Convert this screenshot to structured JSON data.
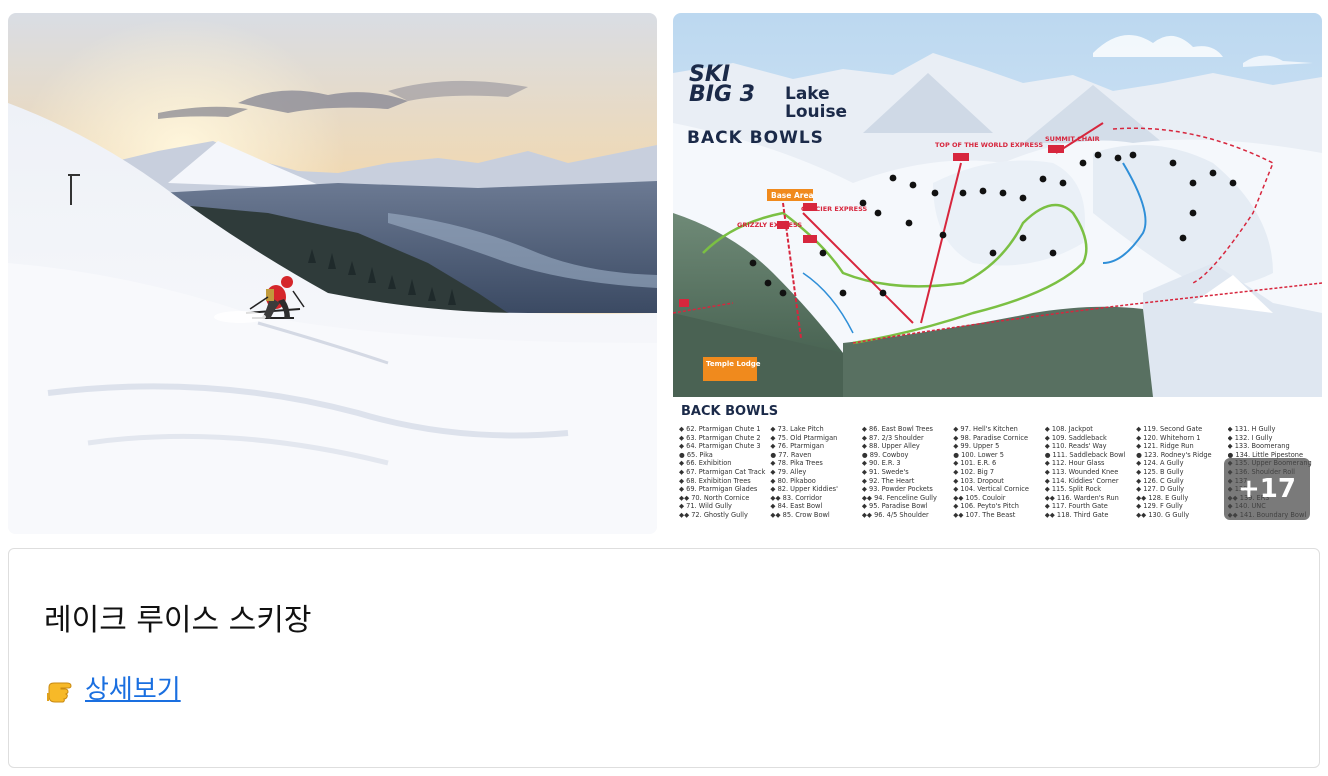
{
  "gallery": {
    "photos": [
      {
        "alt_icon": "skier-photo"
      },
      {
        "alt_icon": "trail-map"
      }
    ],
    "more_count_label": "+17"
  },
  "trail_map": {
    "logo_ski": "SKI BIG 3",
    "logo_resort": "Lake Louise",
    "area_title": "BACK BOWLS",
    "legend_heading": "BACK BOWLS",
    "base_area_label": "Base Area",
    "temple_lodge_label": "Temple Lodge",
    "lifts": [
      "SUMMIT CHAIR",
      "TOP OF THE WORLD EXPRESS",
      "GLACIER EXPRESS",
      "GRIZZLY EXPRESS"
    ],
    "legend_columns": [
      [
        "62. Ptarmigan Chute 1",
        "63. Ptarmigan Chute 2",
        "64. Ptarmigan Chute 3",
        "65. Pika",
        "66. Exhibition",
        "67. Ptarmigan Cat Track",
        "68. Exhibition Trees",
        "69. Ptarmigan Glades",
        "70. North Cornice",
        "71. Wild Gully",
        "72. Ghostly Gully"
      ],
      [
        "73. Lake Pitch",
        "75. Old Ptarmigan",
        "76. Ptarmigan",
        "77. Raven",
        "78. Pika Trees",
        "79. Alley",
        "80. Pikaboo",
        "82. Upper Kiddies'",
        "83. Corridor",
        "84. East Bowl",
        "85. Crow Bowl"
      ],
      [
        "86. East Bowl Trees",
        "87. 2/3 Shoulder",
        "88. Upper Alley",
        "89. Cowboy",
        "90. E.R. 3",
        "91. Swede's",
        "92. The Heart",
        "93. Powder Pockets",
        "94. Fenceline Gully",
        "95. Paradise Bowl",
        "96. 4/5 Shoulder"
      ],
      [
        "97. Hell's Kitchen",
        "98. Paradise Cornice",
        "99. Upper 5",
        "100. Lower 5",
        "101. E.R. 6",
        "102. Big 7",
        "103. Dropout",
        "104. Vertical Cornice",
        "105. Couloir",
        "106. Peyto's Pitch",
        "107. The Beast"
      ],
      [
        "108. Jackpot",
        "109. Saddleback",
        "110. Reads' Way",
        "111. Saddleback Bowl",
        "112. Hour Glass",
        "113. Wounded Knee",
        "114. Kiddies' Corner",
        "115. Split Rock",
        "116. Warden's Run",
        "117. Fourth Gate",
        "118. Third Gate"
      ],
      [
        "119. Second Gate",
        "120. Whitehorn 1",
        "121. Ridge Run",
        "123. Rodney's Ridge",
        "124. A Gully",
        "125. B Gully",
        "126. C Gully",
        "127. D Gully",
        "128. E Gully",
        "129. F Gully",
        "130. G Gully"
      ],
      [
        "131. H Gully",
        "132. I Gully",
        "133. Boomerang",
        "134. Little Pipestone",
        "135. Upper Boomerang",
        "136. Shoulder Roll",
        "137.",
        "138.",
        "139. ER3",
        "140. UNC",
        "141. Boundary Bowl"
      ]
    ]
  },
  "card": {
    "title": "레이크 루이스 스키장",
    "link_label": "상세보기",
    "link_icon": "pointing-hand-icon"
  },
  "colors": {
    "link": "#1a6fe0",
    "badge_bg": "#464646",
    "navy": "#1b2a49",
    "map_red": "#d7263d",
    "map_green": "#7bc043"
  }
}
